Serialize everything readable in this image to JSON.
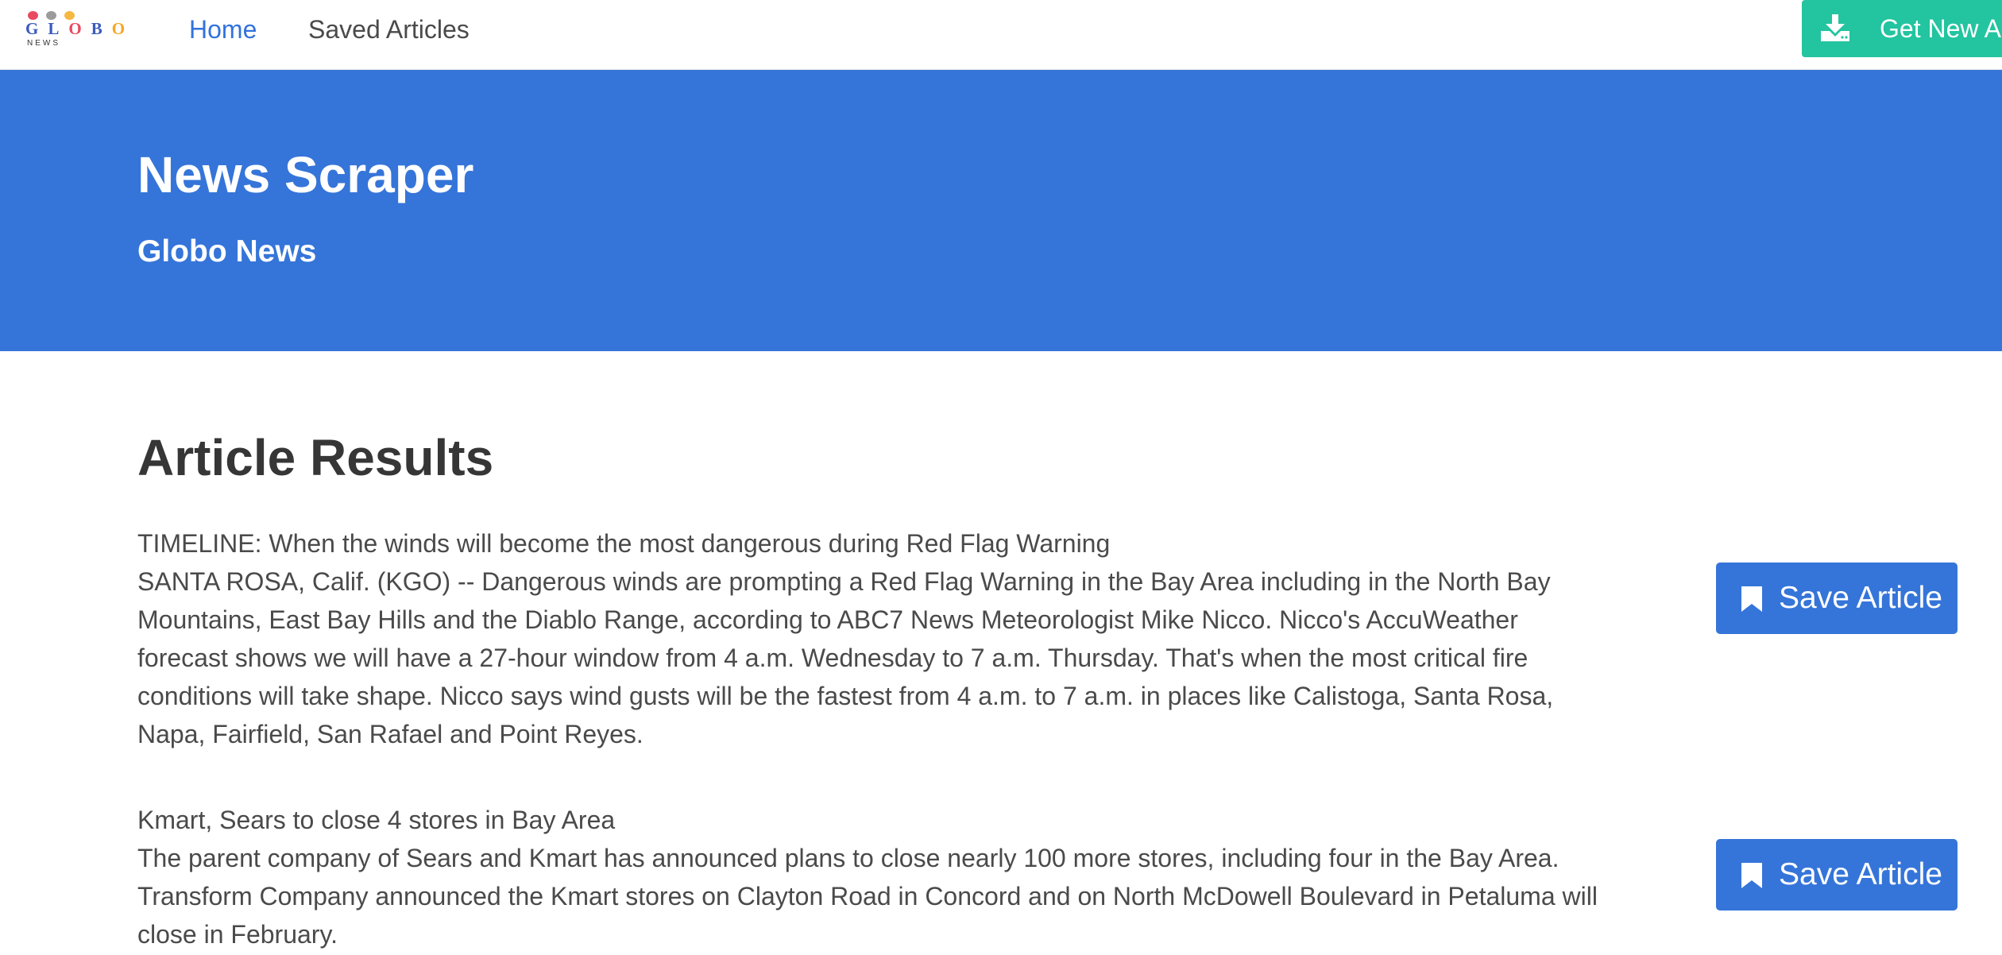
{
  "brand": {
    "logo_word": "GLOBO",
    "logo_sub": "NEWS",
    "logo_colors": [
      "#e84a5f",
      "#9b9b9b",
      "#f5b942"
    ],
    "logo_letter_colors": [
      "#3a5bbf",
      "#3a5bbf",
      "#e84a5f",
      "#3a5bbf",
      "#f5a623"
    ]
  },
  "nav": {
    "home": "Home",
    "saved": "Saved Articles",
    "get_new": "Get New Articles",
    "get_new_icon": "download-icon"
  },
  "hero": {
    "title": "News Scraper",
    "subtitle": "Globo News"
  },
  "results": {
    "title": "Article Results",
    "save_label": "Save Article",
    "save_icon": "bookmark-icon",
    "articles": [
      {
        "headline": "TIMELINE: When the winds will become the most dangerous during Red Flag Warning",
        "summary": "SANTA ROSA, Calif. (KGO) -- Dangerous winds are prompting a Red Flag Warning in the Bay Area including in the North Bay Mountains, East Bay Hills and the Diablo Range, according to ABC7 News Meteorologist Mike Nicco. Nicco's AccuWeather forecast shows we will have a 27-hour window from 4 a.m. Wednesday to 7 a.m. Thursday. That's when the most critical fire conditions will take shape. Nicco says wind gusts will be the fastest from 4 a.m. to 7 a.m. in places like Calistoga, Santa Rosa, Napa, Fairfield, San Rafael and Point Reyes."
      },
      {
        "headline": "Kmart, Sears to close 4 stores in Bay Area",
        "summary": "The parent company of Sears and Kmart has announced plans to close nearly 100 more stores, including four in the Bay Area. Transform Company announced the Kmart stores on Clayton Road in Concord and on North McDowell Boulevard in Petaluma will close in February."
      }
    ]
  },
  "colors": {
    "primary": "#3575d9",
    "success": "#23c4a0",
    "text": "#363636"
  }
}
